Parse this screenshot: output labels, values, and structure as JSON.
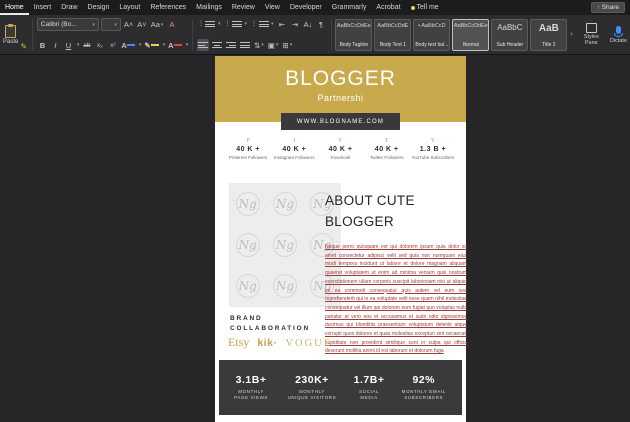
{
  "glyphs": {
    "caret": "▾",
    "share_arrow": "↑",
    "bold": "B",
    "italic": "I",
    "underline": "U",
    "strike": "ab",
    "subscript": "x₂",
    "superscript": "x²",
    "grow_font": "A˄",
    "shrink_font": "A˅",
    "change_case": "Aa",
    "clear_format": "A",
    "font_color": "A",
    "text_effects": "A",
    "highlight": "✎",
    "outdent": "⇤",
    "indent": "⇥",
    "sort": "A↓",
    "pilcrow": "¶",
    "line_spacing": "⇅",
    "borders": "⊞",
    "shading": "▣",
    "gallery_more": "›",
    "bullets_dots": "⋮",
    "numbering_dots": "⋮",
    "multilevel_dots": "⋮"
  },
  "menu_bar": {
    "items": [
      "Home",
      "Insert",
      "Draw",
      "Design",
      "Layout",
      "References",
      "Mailings",
      "Review",
      "View",
      "Developer",
      "Grammarly",
      "Acrobat"
    ],
    "active_item": "Home",
    "tell_me_label": "Tell me",
    "share_label": "Share"
  },
  "ribbon": {
    "paste_label": "Paste",
    "font_name": "Calibri (Bo...",
    "font_size": "",
    "styles": [
      {
        "preview": "AaBbCcDdEe",
        "label": "Body Tagline"
      },
      {
        "preview": "AaBbCcDdE",
        "label": "Body Text 1"
      },
      {
        "preview": "• AaBbCcD",
        "label": "Body text bul..."
      },
      {
        "preview": "AaBbCcDdEe",
        "label": "Normal"
      },
      {
        "preview": "AaBbC",
        "label": "Sub Header"
      },
      {
        "preview": "AaB",
        "label": "Title 2"
      }
    ],
    "styles_pane_label": "Styles Pane",
    "dictate_label": "Dictate"
  },
  "document": {
    "colors": {
      "header_gold": "#C8AA4D",
      "site_bar": "#39393b",
      "body_text_red": "#9E3B38",
      "bottom_bar": "#3A3A3C",
      "logo_gold": "#C7A050"
    },
    "header": {
      "title": "BLOGGER",
      "subtitle": "Partnershi",
      "website": "WWW.BLOGNAME.COM"
    },
    "placeholder_monogram": "Ng",
    "social_stats": [
      {
        "icon": "P",
        "value": "40 K +",
        "label": "Pinterest Followers"
      },
      {
        "icon": "I",
        "value": "40 K +",
        "label": "Instagram Followers"
      },
      {
        "icon": "F",
        "value": "40 K +",
        "label": "Facebook"
      },
      {
        "icon": "T",
        "value": "40 K +",
        "label": "Twitter Followers"
      },
      {
        "icon": "Y",
        "value": "1.3 B +",
        "label": "YouTube Subscribers"
      }
    ],
    "about": {
      "heading": "ABOUT CUTE BLOGGER",
      "body": "Neque porro quisquam est qui dolorem ipsum quia dolor sit amet consectetur adipisci velit sed quia non numquam eius modi tempora incidunt ut labore et dolore magnam aliquam quaerat voluptatem ut enim ad minima veniam quis nostrum exercitationem ullam corporis suscipit laboriosam nisi ut aliquid ex ea commodi consequatur quis autem vel eum iure reprehenderit qui in ea voluptate velit esse quam nihil molestiae consequatur vel illum qui dolorem eum fugiat quo voluptas nulla pariatur at vero eos et accusamus et iusto odio dignissimos ducimus qui blanditiis praesentium voluptatum deleniti atque corrupti quos dolores et quas molestias excepturi sint occaecati cupiditate non provident similique sunt in culpa qui officia deserunt mollitia animi id est laborum et dolorum fuga"
    },
    "brand": {
      "heading_line1": "BRAND",
      "heading_line2": "COLLABORATION",
      "logos": [
        "Etsy",
        "kik·",
        "VOGUE"
      ]
    },
    "bottom_stats": [
      {
        "value": "3.1B+",
        "label_line1": "MONTHLY",
        "label_line2": "PAGE VIEWS"
      },
      {
        "value": "230K+",
        "label_line1": "MONTHLY",
        "label_line2": "UNIQUE VISITORS"
      },
      {
        "value": "1.7B+",
        "label_line1": "SOCIAL",
        "label_line2": "MEDIA"
      },
      {
        "value": "92%",
        "label_line1": "MONTHLY EMAIL",
        "label_line2": "SUBSCRIBERS"
      }
    ]
  }
}
